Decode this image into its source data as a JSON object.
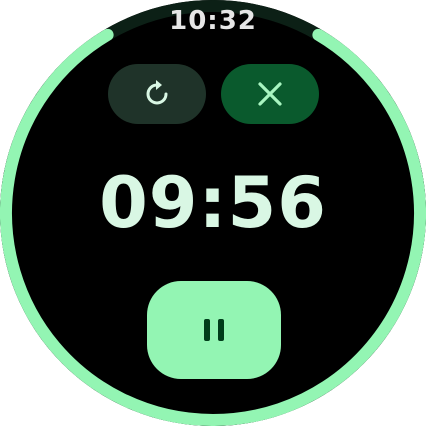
{
  "status_bar": {
    "time": "10:32"
  },
  "timer": {
    "remaining": "09:56",
    "progress_fraction": 0.83
  },
  "controls": {
    "reset_icon": "reset-icon",
    "cancel_icon": "close-icon",
    "pause_icon": "pause-icon"
  },
  "colors": {
    "progress": "#93f5b3",
    "reset_bg": "#1f3329",
    "cancel_bg": "#0a5a2d",
    "pause_bg": "#93f5b3",
    "timer_text": "#d9f7e4"
  }
}
